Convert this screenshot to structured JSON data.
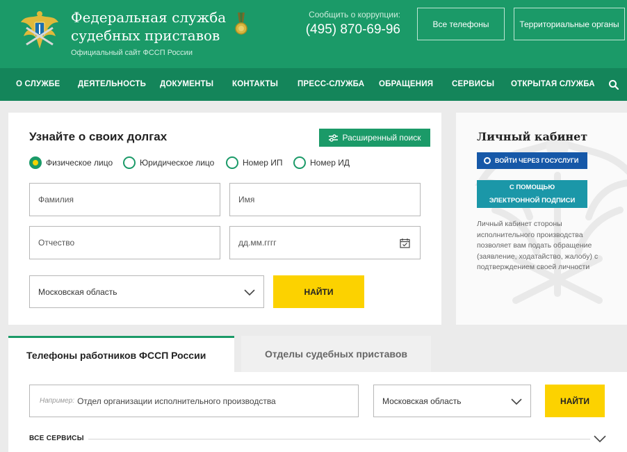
{
  "header": {
    "title_line1": "Федеральная служба",
    "title_line2": "судебных приставов",
    "subtitle": "Официальный сайт ФССП России",
    "corruption_label": "Сообщить о коррупции:",
    "corruption_phone": "(495) 870-69-96",
    "btn_phones": "Все телефоны",
    "btn_regions": "Территориальные органы"
  },
  "nav": {
    "items": [
      "О СЛУЖБЕ",
      "ДЕЯТЕЛЬНОСТЬ",
      "ДОКУМЕНТЫ",
      "КОНТАКТЫ",
      "ПРЕСС-СЛУЖБА",
      "ОБРАЩЕНИЯ",
      "СЕРВИСЫ",
      "ОТКРЫТАЯ СЛУЖБА"
    ]
  },
  "debt": {
    "title": "Узнайте о своих долгах",
    "advanced_search": "Расширенный поиск",
    "radios": [
      "Физическое лицо",
      "Юридическое лицо",
      "Номер ИП",
      "Номер ИД"
    ],
    "selected_radio": "Физическое лицо",
    "placeholder_lastname": "Фамилия",
    "placeholder_firstname": "Имя",
    "placeholder_patronymic": "Отчество",
    "placeholder_date": "дд.мм.гггг",
    "region": "Московская область",
    "find": "НАЙТИ"
  },
  "cabinet": {
    "title": "Личный кабинет",
    "gosuslugi": "ВОЙТИ ЧЕРЕЗ ГОСУСЛУГИ",
    "eds_line1": "С ПОМОЩЬЮ",
    "eds_line2": "ЭЛЕКТРОННОЙ ПОДПИСИ",
    "description": "Личный кабинет стороны исполнительного производства позволяет вам подать обращение (заявление, ходатайство, жалобу) с подтверждением своей личности"
  },
  "phones": {
    "tab_active": "Телефоны работников ФССП России",
    "tab_inactive": "Отделы судебных приставов",
    "example_label": "Например:",
    "example_value": "Отдел организации исполнительного производства",
    "region": "Московская область",
    "find": "НАЙТИ",
    "all_services": "ВСЕ СЕРВИСЫ"
  },
  "colors": {
    "brand_green": "#1b9a68",
    "nav_green": "#14855a",
    "accent_yellow": "#fcd200",
    "gos_blue": "#1658a8",
    "eds_teal": "#1b97a8"
  },
  "icons": {
    "emblem": "fssp-emblem-icon",
    "medal": "medal-icon",
    "search": "search-icon",
    "filter": "filter-sliders-icon",
    "calendar": "calendar-check-icon",
    "chevron": "chevron-down-icon"
  }
}
